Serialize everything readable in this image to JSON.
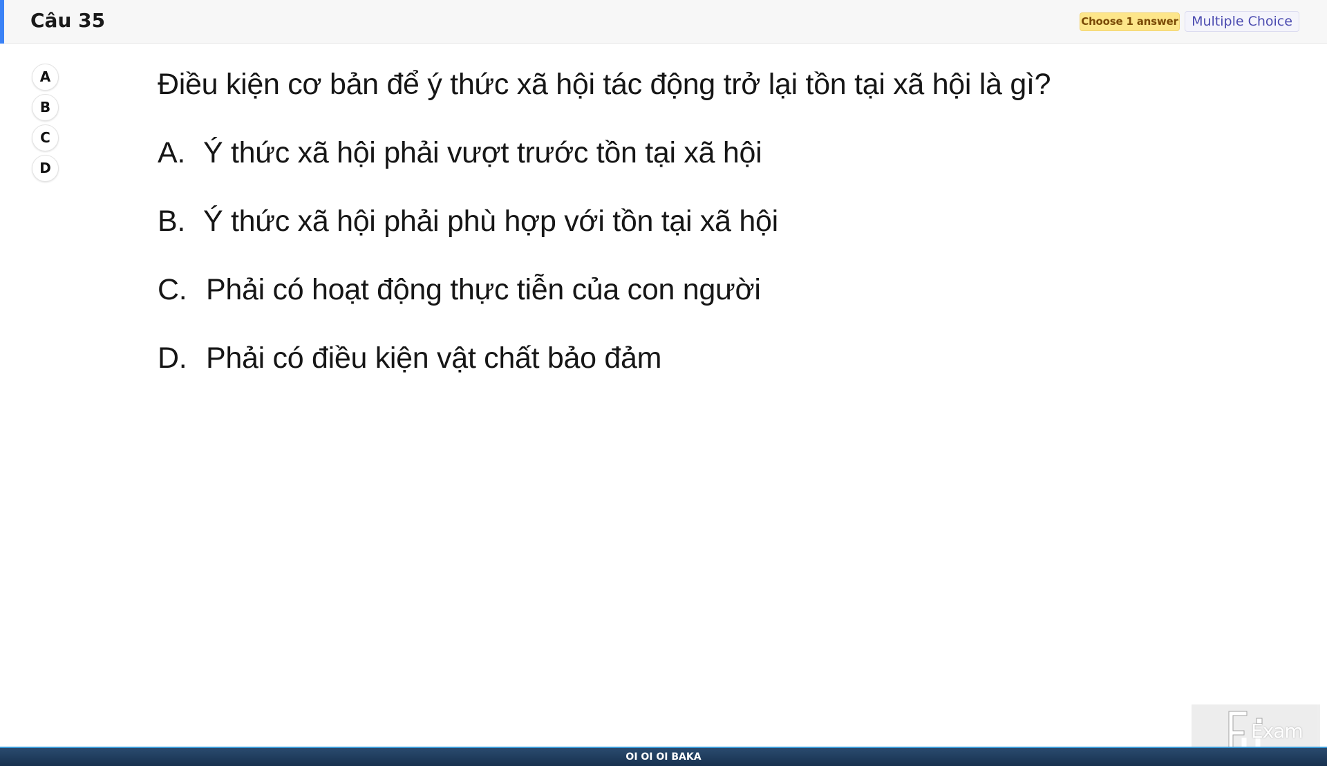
{
  "header": {
    "title": "Câu 35",
    "badge_choose": "Choose 1 answer",
    "badge_type": "Multiple Choice",
    "accent_color": "#3b82f6"
  },
  "option_buttons": [
    "A",
    "B",
    "C",
    "D"
  ],
  "question": {
    "text": "Điều kiện cơ bản để ý thức xã hội tác động trở lại tồn tại xã hội là gì?",
    "answers": [
      {
        "letter": "A.",
        "text": "Ý thức xã hội phải vượt trước tồn tại xã hội"
      },
      {
        "letter": "B.",
        "text": "Ý thức xã hội phải phù hợp với tồn tại xã hội"
      },
      {
        "letter": "C.",
        "text": "Phải có hoạt động thực tiễn của con người"
      },
      {
        "letter": "D.",
        "text": "Phải có điều kiện vật chất bảo đảm"
      }
    ]
  },
  "watermark": {
    "text": "Exam",
    "icon": "fu-logo-icon"
  },
  "footer": {
    "text": "OI OI OI BAKA"
  }
}
